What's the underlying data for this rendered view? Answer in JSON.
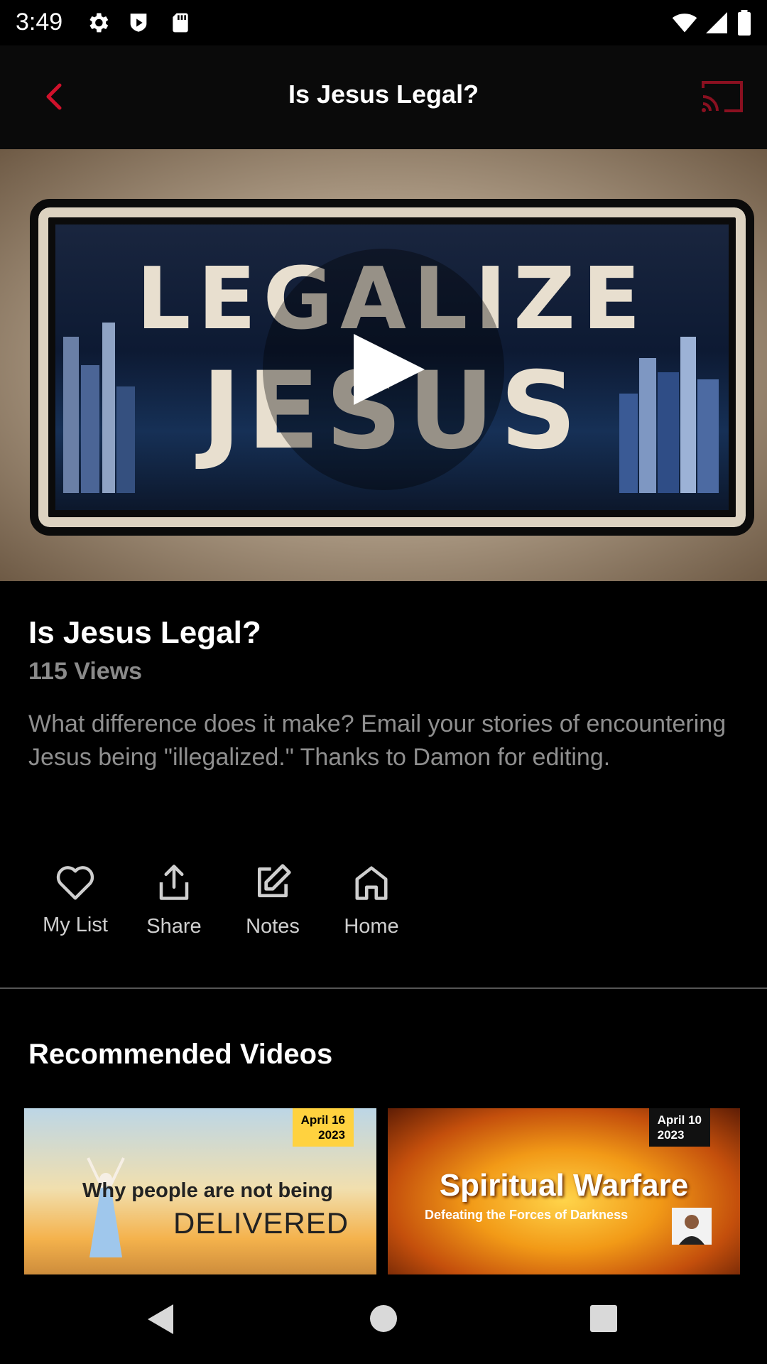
{
  "status_bar": {
    "time": "3:49",
    "icons": [
      "gear-icon",
      "shield-play-icon",
      "sd-card-icon",
      "wifi-icon",
      "signal-icon",
      "battery-icon"
    ]
  },
  "app_bar": {
    "title": "Is Jesus Legal?",
    "back_icon": "chevron-left-icon",
    "cast_icon": "cast-icon",
    "accent_color": "#d0112b"
  },
  "video": {
    "thumbnail_text_line1": "LEGALIZE",
    "thumbnail_text_line2": "JESUS",
    "play_icon": "play-icon"
  },
  "details": {
    "title": "Is Jesus Legal?",
    "views": "115 Views",
    "description": "What difference does it make? Email your stories of encountering Jesus being \"illegalized.\" Thanks to Damon for editing."
  },
  "actions": [
    {
      "label": "My List",
      "icon": "heart-icon"
    },
    {
      "label": "Share",
      "icon": "share-icon"
    },
    {
      "label": "Notes",
      "icon": "edit-icon"
    },
    {
      "label": "Home",
      "icon": "home-icon"
    }
  ],
  "recommended": {
    "title": "Recommended Videos",
    "videos": [
      {
        "date_line1": "April 16",
        "date_line2": "2023",
        "text_line1": "Why people are not being",
        "text_line2": "DELIVERED"
      },
      {
        "date_line1": "April 10",
        "date_line2": "2023",
        "text_line1": "Spiritual Warfare",
        "text_line2": "Defeating the Forces of Darkness"
      }
    ]
  },
  "nav_bar": {
    "icons": [
      "back-triangle-icon",
      "home-circle-icon",
      "recents-square-icon"
    ]
  }
}
